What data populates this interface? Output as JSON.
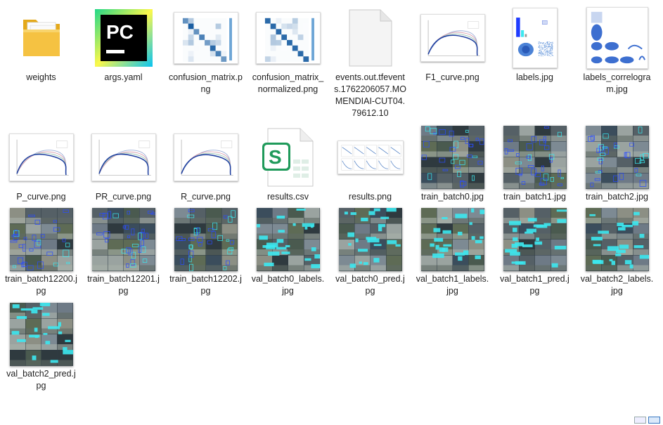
{
  "files": [
    {
      "name": "weights",
      "kind": "folder"
    },
    {
      "name": "args.yaml",
      "kind": "pycharm"
    },
    {
      "name": "confusion_matrix.png",
      "kind": "matrix"
    },
    {
      "name": "confusion_matrix_normalized.png",
      "kind": "matrix_norm"
    },
    {
      "name": "events.out.tfevents.1762206057.MOMENDIAI-CUT04.79612.10",
      "kind": "blank"
    },
    {
      "name": "F1_curve.png",
      "kind": "curve"
    },
    {
      "name": "labels.jpg",
      "kind": "labels"
    },
    {
      "name": "labels_correlogram.jpg",
      "kind": "correlogram"
    },
    {
      "name": "P_curve.png",
      "kind": "curve"
    },
    {
      "name": "PR_curve.png",
      "kind": "curve"
    },
    {
      "name": "R_curve.png",
      "kind": "curve"
    },
    {
      "name": "results.csv",
      "kind": "csv"
    },
    {
      "name": "results.png",
      "kind": "results"
    },
    {
      "name": "train_batch0.jpg",
      "kind": "batch"
    },
    {
      "name": "train_batch1.jpg",
      "kind": "batch"
    },
    {
      "name": "train_batch2.jpg",
      "kind": "batch"
    },
    {
      "name": "train_batch12200.jpg",
      "kind": "batch"
    },
    {
      "name": "train_batch12201.jpg",
      "kind": "batch"
    },
    {
      "name": "train_batch12202.jpg",
      "kind": "batch"
    },
    {
      "name": "val_batch0_labels.jpg",
      "kind": "valbatch"
    },
    {
      "name": "val_batch0_pred.jpg",
      "kind": "valbatch"
    },
    {
      "name": "val_batch1_labels.jpg",
      "kind": "valbatch"
    },
    {
      "name": "val_batch1_pred.jpg",
      "kind": "valbatch"
    },
    {
      "name": "val_batch2_labels.jpg",
      "kind": "valbatch"
    },
    {
      "name": "val_batch2_pred.jpg",
      "kind": "valbatch"
    }
  ],
  "icons": {
    "pycharm_text": "PC",
    "csv_letter": "S"
  },
  "colors": {
    "folder": "#f5c242",
    "accent_cyan": "#3ce8f0",
    "accent_blue": "#2a4cff",
    "csv_green": "#1f9a5a"
  },
  "view_buttons": [
    "details-view",
    "large-icons-view"
  ],
  "selected_view": "large-icons-view"
}
